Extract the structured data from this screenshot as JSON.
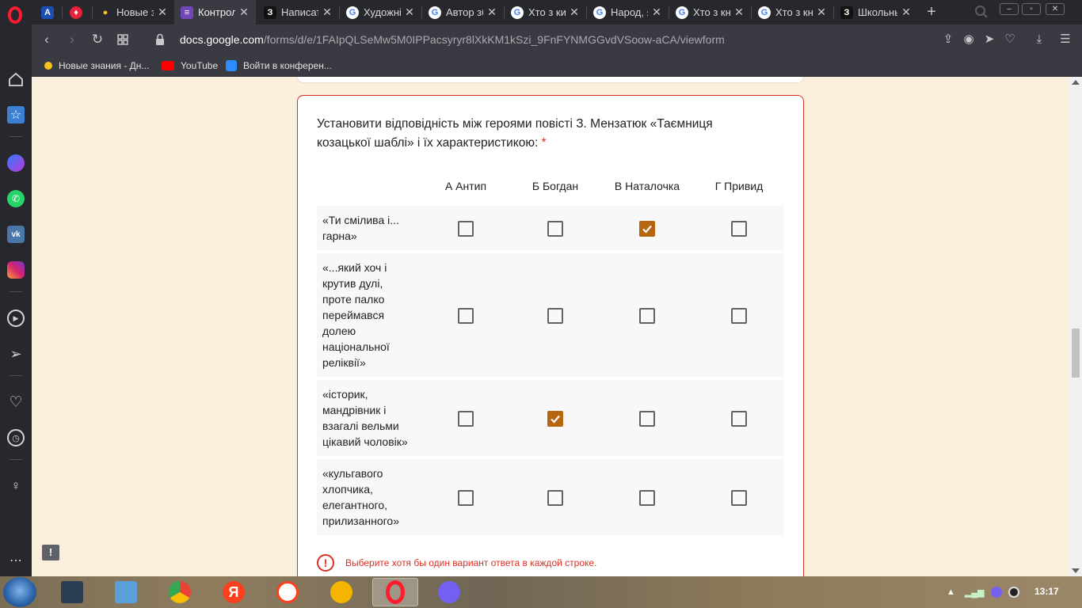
{
  "tabs": [
    {
      "label": "",
      "icon": "a-icon"
    },
    {
      "label": "",
      "icon": "diamond-icon"
    },
    {
      "label": "Новые зн",
      "icon": "bulb-icon"
    },
    {
      "label": "Контроль",
      "icon": "forms-icon",
      "active": true
    },
    {
      "label": "Написать",
      "icon": "z-icon"
    },
    {
      "label": "Художній",
      "icon": "google-icon"
    },
    {
      "label": "Автор зб",
      "icon": "google-icon"
    },
    {
      "label": "Хто з киї",
      "icon": "google-icon"
    },
    {
      "label": "Народ, як",
      "icon": "google-icon"
    },
    {
      "label": "Хто з кня",
      "icon": "google-icon"
    },
    {
      "label": "Хто з кня",
      "icon": "google-icon"
    },
    {
      "label": "Школьны",
      "icon": "z-icon"
    }
  ],
  "address": {
    "host": "docs.google.com",
    "path": "/forms/d/e/1FAIpQLSeMw5M0IPPacsyryr8lXkKM1kSzi_9FnFYNMGGvdVSoow-aCA/viewform"
  },
  "bookmarks": [
    {
      "label": "Новые знания - Дн...",
      "icon": "bulb-icon"
    },
    {
      "label": "YouTube",
      "icon": "youtube-icon"
    },
    {
      "label": "Войти в конферен...",
      "icon": "zoom-icon"
    }
  ],
  "question": {
    "title": "Установити відповідність між героями повісті З. Мензатюк «Таємниця козацької шаблі» і їх характеристикою:",
    "required_mark": "*",
    "columns": [
      "А Антип",
      "Б Богдан",
      "В Наталочка",
      "Г Привид"
    ],
    "rows": [
      {
        "label": "«Ти смілива і... гарна»",
        "checked": [
          false,
          false,
          true,
          false
        ]
      },
      {
        "label": "«...який хоч і крутив дулі, проте палко переймався долею національної реліквії»",
        "checked": [
          false,
          false,
          false,
          false
        ]
      },
      {
        "label": "«історик, мандрівник і взагалі вельми цікавий чоловік»",
        "checked": [
          false,
          true,
          false,
          false
        ]
      },
      {
        "label": "«кульгавого хлопчика, елегантного, прилизанного»",
        "checked": [
          false,
          false,
          false,
          false
        ]
      }
    ],
    "error": "Выберите хотя бы один вариант ответа в каждой строке."
  },
  "colors": {
    "accent": "#b8650f",
    "error": "#d93025",
    "page_bg": "#fbf0dd"
  },
  "taskbar": {
    "clock": "13:17"
  }
}
